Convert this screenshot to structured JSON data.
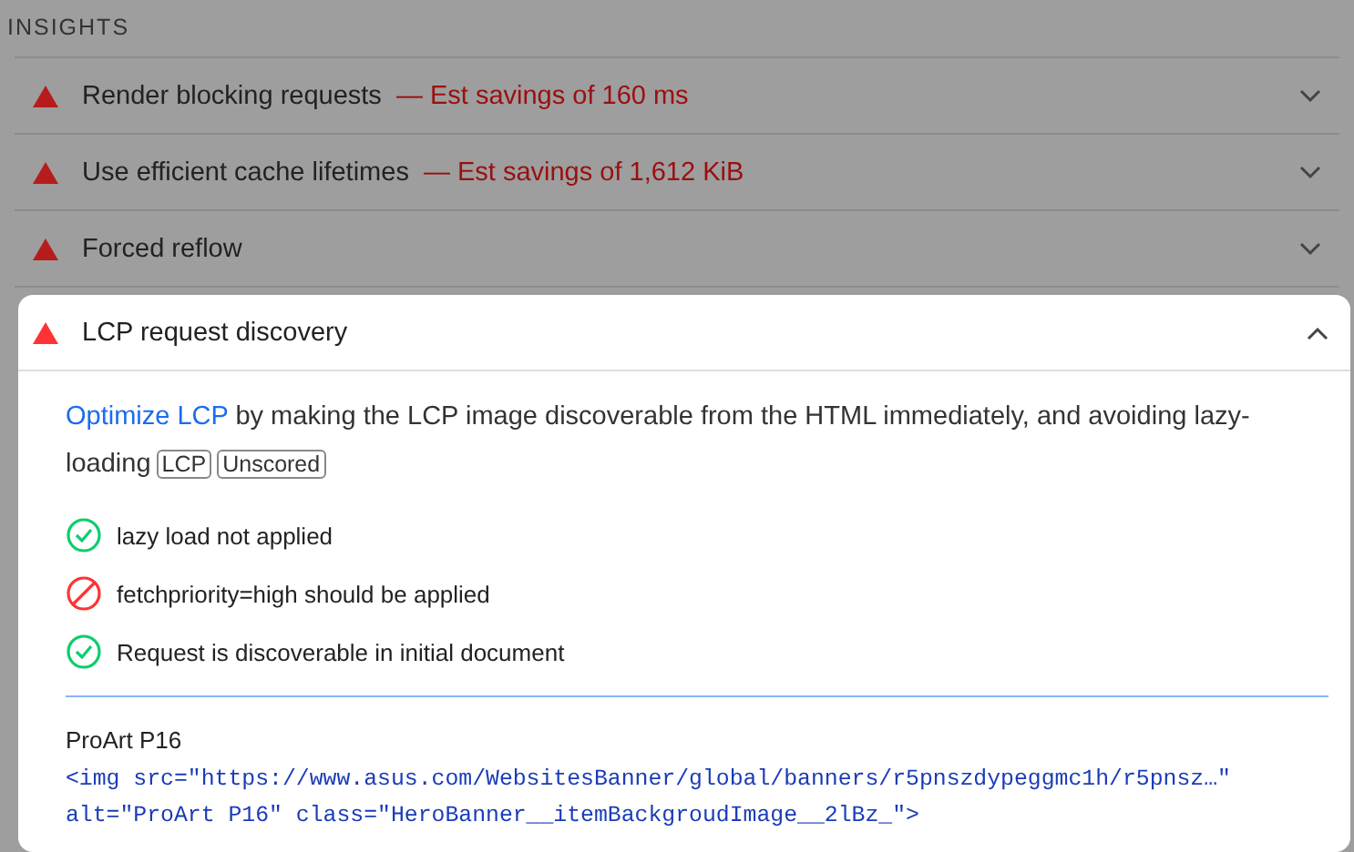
{
  "section_title": "INSIGHTS",
  "insights": [
    {
      "title": "Render blocking requests",
      "savings": "— Est savings of 160 ms",
      "expanded": false
    },
    {
      "title": "Use efficient cache lifetimes",
      "savings": "— Est savings of 1,612 KiB",
      "expanded": false
    },
    {
      "title": "Forced reflow",
      "expanded": false
    },
    {
      "title": "LCP request discovery",
      "expanded": true,
      "description": {
        "link": "Optimize LCP",
        "text": " by making the LCP image discoverable from the HTML immediately, and avoiding lazy-loading",
        "badges": [
          "LCP",
          "Unscored"
        ]
      },
      "checks": [
        {
          "kind": "pass",
          "label": "lazy load not applied"
        },
        {
          "kind": "fail",
          "label": "fetchpriority=high should be applied"
        },
        {
          "kind": "pass",
          "label": "Request is discoverable in initial document"
        }
      ],
      "node": {
        "label": "ProArt P16",
        "code_lines": [
          "<img src=\"https://www.asus.com/WebsitesBanner/global/banners/r5pnszdypeggmc1h/r5pnsz…\"",
          "alt=\"ProArt P16\" class=\"HeroBanner__itemBackgroudImage__2lBz_\">"
        ]
      }
    }
  ]
}
